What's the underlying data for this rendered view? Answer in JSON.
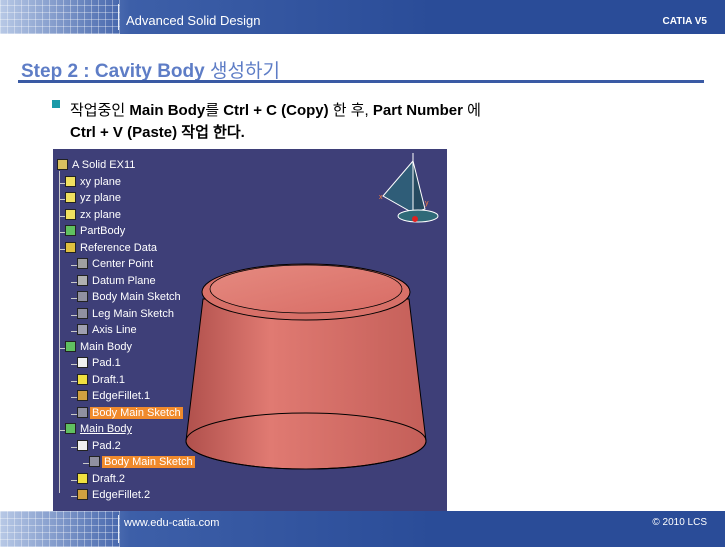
{
  "header": {
    "title": "Advanced Solid Design",
    "brand": "CATIA V5"
  },
  "slide": {
    "title_en": "Step 2 : Cavity Body ",
    "title_kr": "생성하기",
    "line1_a": "작업중인 ",
    "line1_b": "Main Body",
    "line1_c": "를 ",
    "line1_d": "Ctrl + C (Copy)",
    "line1_e": " 한 후, ",
    "line1_f": "Part Number",
    "line1_g": " 에",
    "line2_a": "Ctrl + V (Paste)",
    "line2_b": " 작업 한다."
  },
  "tree": {
    "items": [
      {
        "label": "A Solid EX11",
        "icon": "part-icon"
      },
      {
        "label": "xy plane",
        "icon": "plane-icon"
      },
      {
        "label": "yz plane",
        "icon": "plane-icon"
      },
      {
        "label": "zx plane",
        "icon": "plane-icon"
      },
      {
        "label": "PartBody",
        "icon": "body-icon"
      },
      {
        "label": "Reference Data",
        "icon": "geoset-icon"
      },
      {
        "label": "Center Point",
        "icon": "point-icon"
      },
      {
        "label": "Datum Plane",
        "icon": "datum-plane-icon"
      },
      {
        "label": "Body Main Sketch",
        "icon": "sketch-icon"
      },
      {
        "label": "Leg Main Sketch",
        "icon": "sketch-icon"
      },
      {
        "label": "Axis Line",
        "icon": "line-icon"
      },
      {
        "label": "Main Body",
        "icon": "body-icon"
      },
      {
        "label": "Pad.1",
        "icon": "pad-icon"
      },
      {
        "label": "Draft.1",
        "icon": "draft-icon"
      },
      {
        "label": "EdgeFillet.1",
        "icon": "fillet-icon"
      },
      {
        "label": "Body Main Sketch",
        "icon": "sketch-icon"
      },
      {
        "label": "Main Body",
        "icon": "body-icon"
      },
      {
        "label": "Pad.2",
        "icon": "pad-icon"
      },
      {
        "label": "Body Main Sketch",
        "icon": "sketch-icon"
      },
      {
        "label": "Draft.2",
        "icon": "draft-icon"
      },
      {
        "label": "EdgeFillet.2",
        "icon": "fillet-icon"
      }
    ]
  },
  "colors": {
    "viewport_bg": "#3e3f78",
    "highlight": "#f08a2c",
    "solid": "#d9706a",
    "accent": "#3a5aa4"
  },
  "footer": {
    "url": "www.edu-catia.com",
    "copyright": "© 2010 LCS"
  }
}
